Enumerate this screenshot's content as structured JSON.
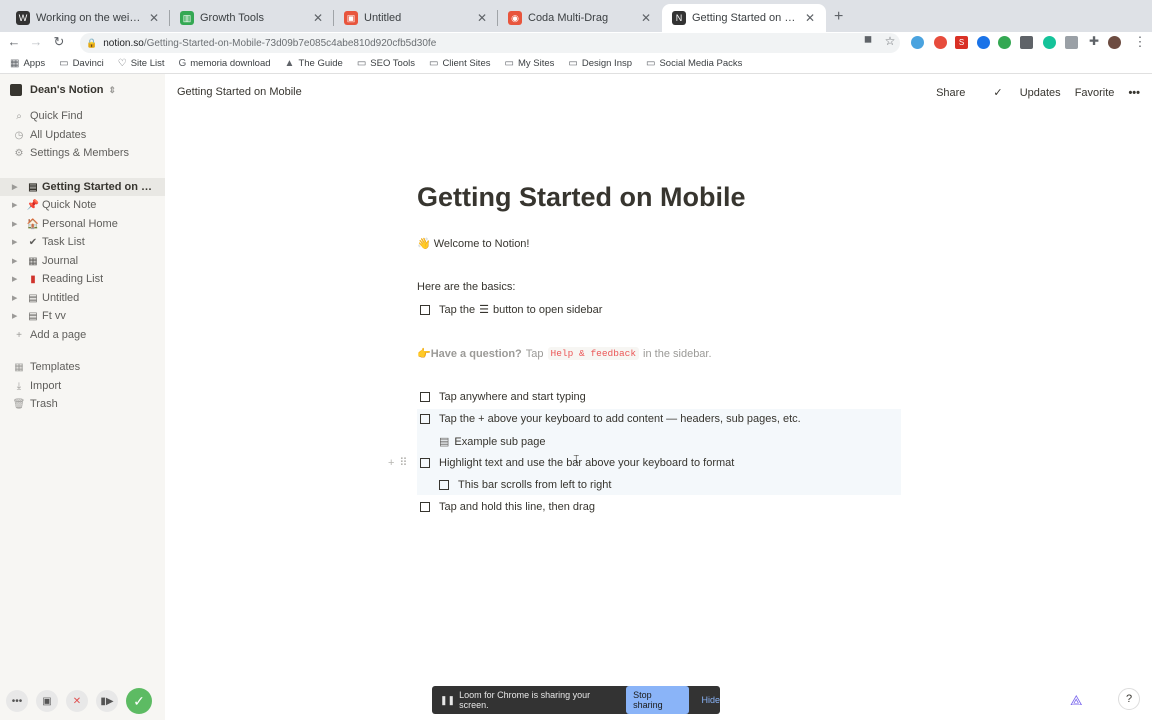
{
  "browser": {
    "tabs": [
      {
        "title": "Working on the weight gaining",
        "favicon": "W",
        "favicon_color": "#333333"
      },
      {
        "title": "Growth Tools",
        "favicon": "▥",
        "favicon_color": "#34a853"
      },
      {
        "title": "Untitled",
        "favicon": "▣",
        "favicon_color": "#e8553d"
      },
      {
        "title": "Coda Multi-Drag",
        "favicon": "◉",
        "favicon_color": "#e8553d"
      },
      {
        "title": "Getting Started on Mobile",
        "favicon": "N",
        "favicon_color": "#333333"
      }
    ],
    "close_glyph": "✕",
    "new_tab_glyph": "+",
    "url_host": "notion.so",
    "url_path": "/Getting-Started-on-Mobile-73d09b7e085c4abe810d920cfb5d30fe",
    "bookmarks": [
      "Apps",
      "Davinci",
      "Site List",
      "memoria download",
      "The Guide",
      "SEO Tools",
      "Client Sites",
      "My Sites",
      "Design Insp",
      "Social Media Packs"
    ]
  },
  "sidebar": {
    "workspace": "Dean's Notion",
    "nav": [
      {
        "label": "Quick Find",
        "icon": "⌕"
      },
      {
        "label": "All Updates",
        "icon": "◷"
      },
      {
        "label": "Settings & Members",
        "icon": "⚙"
      }
    ],
    "pages": [
      {
        "label": "Getting Started on Mo...",
        "icon": "▤"
      },
      {
        "label": "Quick Note",
        "icon": "📌"
      },
      {
        "label": "Personal Home",
        "icon": "🏠"
      },
      {
        "label": "Task List",
        "icon": "✔"
      },
      {
        "label": "Journal",
        "icon": "▦"
      },
      {
        "label": "Reading List",
        "icon": "▮"
      },
      {
        "label": "Untitled",
        "icon": "▤"
      },
      {
        "label": "Ft vv",
        "icon": "▤"
      }
    ],
    "add_page": "Add a page",
    "footer": [
      {
        "label": "Templates",
        "icon": "▦"
      },
      {
        "label": "Import",
        "icon": "⤓"
      },
      {
        "label": "Trash",
        "icon": "🗑"
      }
    ]
  },
  "topbar": {
    "breadcrumb": "Getting Started on Mobile",
    "share": "Share",
    "updates": "Updates",
    "favorite": "Favorite",
    "more": "•••"
  },
  "page": {
    "title": "Getting Started on Mobile",
    "welcome_emoji": "👋",
    "welcome": "Welcome to Notion!",
    "basics": "Here are the basics:",
    "todo_sidebar_pre": "Tap the",
    "todo_sidebar_glyph": "☰",
    "todo_sidebar_post": "button to open sidebar",
    "callout_emoji": "👉",
    "callout_strong": "Have a question?",
    "callout_tap": "Tap",
    "callout_code": "Help & feedback",
    "callout_tail": "in the sidebar.",
    "todos": [
      "Tap anywhere and start typing",
      "Tap the + above your keyboard to add content — headers, sub pages, etc.",
      "Highlight text and use the bar above your keyboard to format",
      "Tap and hold this line, then drag"
    ],
    "sub_page": "Example sub page",
    "sub_todo": "This bar scrolls from left to right"
  },
  "share_bar": {
    "message": "Loom for Chrome is sharing your screen.",
    "stop": "Stop sharing",
    "hide": "Hide"
  },
  "help_label": "?"
}
